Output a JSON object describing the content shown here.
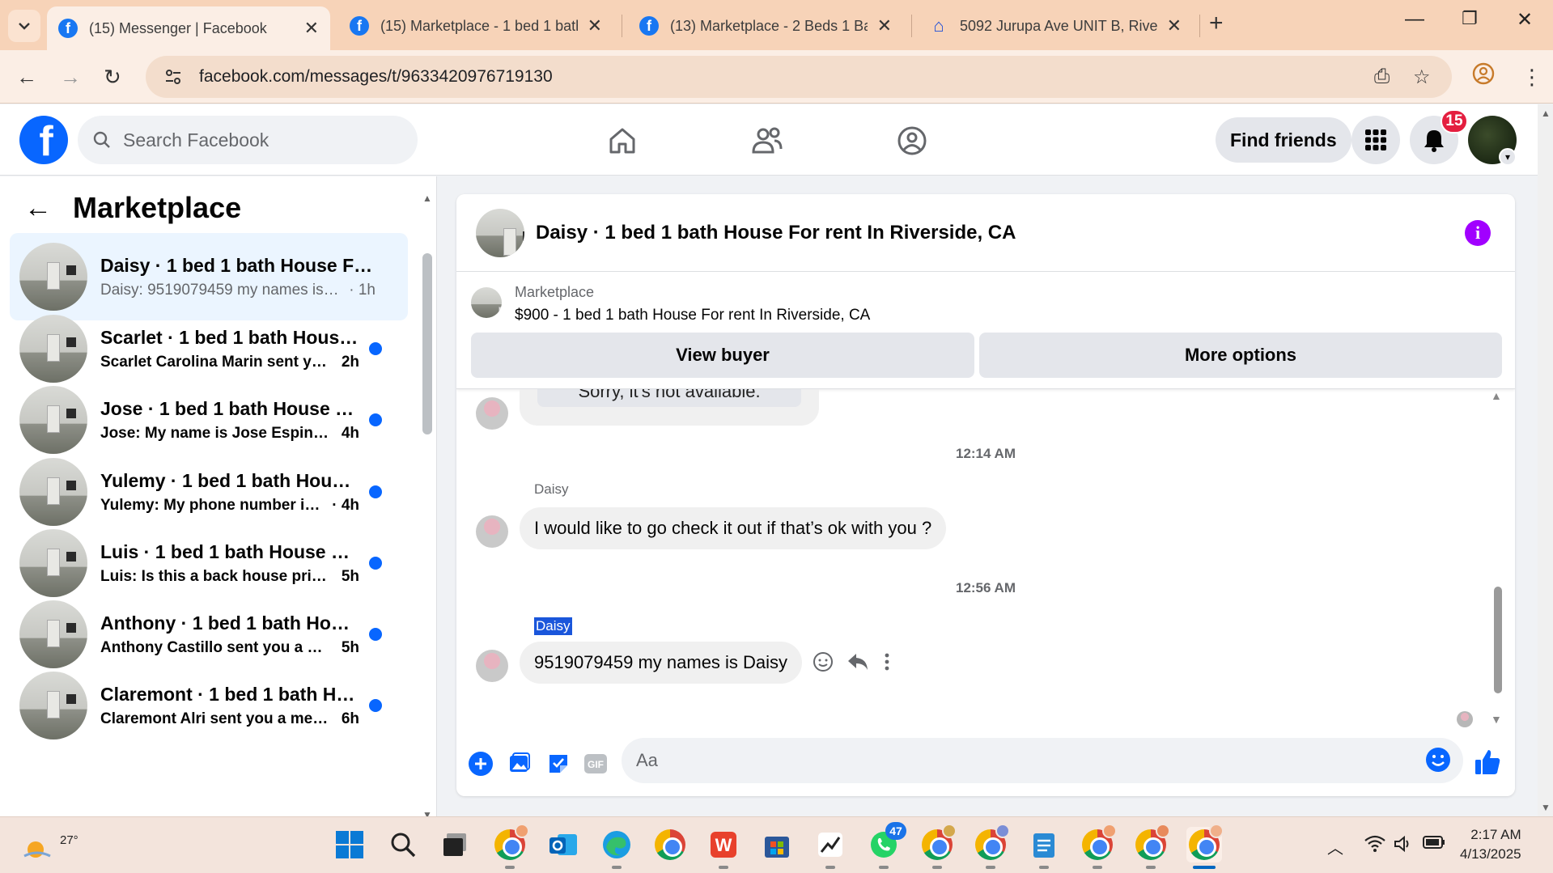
{
  "browser": {
    "tabs": [
      {
        "title": "(15) Messenger | Facebook",
        "active": true,
        "icon": "facebook-icon"
      },
      {
        "title": "(15) Marketplace - 1 bed 1 bath",
        "active": false,
        "icon": "facebook-icon"
      },
      {
        "title": "(13) Marketplace - 2 Beds 1 Bat",
        "active": false,
        "icon": "facebook-icon"
      },
      {
        "title": "5092 Jurupa Ave UNIT B, Riversi",
        "active": false,
        "icon": "zillow-icon"
      }
    ],
    "new_tab_glyph": "+",
    "url": "facebook.com/messages/t/9633420976719130"
  },
  "fb_header": {
    "search_placeholder": "Search Facebook",
    "find_friends": "Find friends",
    "notification_count": "15"
  },
  "sidebar": {
    "title": "Marketplace",
    "conversations": [
      {
        "name": "Daisy · 1 bed 1 bath House For r...",
        "snippet": "Daisy: 9519079459 my names is Da...",
        "time": "· 1h",
        "unread": false,
        "active": true
      },
      {
        "name": "Scarlet · 1 bed 1 bath House Fo...",
        "snippet": "Scarlet Carolina Marin sent you ...",
        "time": "2h",
        "unread": true,
        "active": false
      },
      {
        "name": "Jose · 1 bed 1 bath House For r...",
        "snippet": "Jose: My name is Jose Espinoza ...",
        "time": "4h",
        "unread": true,
        "active": false
      },
      {
        "name": "Yulemy · 1 bed 1 bath House F...",
        "snippet": "Yulemy: My phone number is 4...",
        "time": "· 4h",
        "unread": true,
        "active": false
      },
      {
        "name": "Luis · 1 bed 1 bath House For r...",
        "snippet": "Luis: Is this a back house private...",
        "time": "5h",
        "unread": true,
        "active": false
      },
      {
        "name": "Anthony · 1 bed 1 bath House ...",
        "snippet": "Anthony Castillo sent you a mes...",
        "time": "5h",
        "unread": true,
        "active": false
      },
      {
        "name": "Claremont · 1 bed 1 bath Hous...",
        "snippet": "Claremont Alri sent you a messa...",
        "time": "6h",
        "unread": true,
        "active": false
      }
    ]
  },
  "chat": {
    "title": "Daisy · 1 bed 1 bath House For rent In Riverside, CA",
    "listing": {
      "kicker": "Marketplace",
      "title": "$900 - 1 bed 1 bath House For rent In Riverside, CA",
      "view_buyer": "View buyer",
      "more_options": "More options"
    },
    "quoted_reply": "Sorry, it's not available.",
    "timestamp_1": "12:14 AM",
    "sender_1": "Daisy",
    "message_1": "I would like to go check it out if that’s ok with you ?",
    "timestamp_2": "12:56 AM",
    "sender_2": "Daisy",
    "message_2": "9519079459 my names is Daisy",
    "composer_placeholder": "Aa"
  },
  "taskbar": {
    "temperature": "27°",
    "whatsapp_badge": "47",
    "time": "2:17 AM",
    "date": "4/13/2025"
  },
  "colors": {
    "facebook_blue": "#0866ff",
    "messenger_purple": "#a100ff",
    "notification_red": "#e41e3f",
    "tabbar_bg": "#f7d3b8",
    "selection_blue": "#1a56db"
  }
}
